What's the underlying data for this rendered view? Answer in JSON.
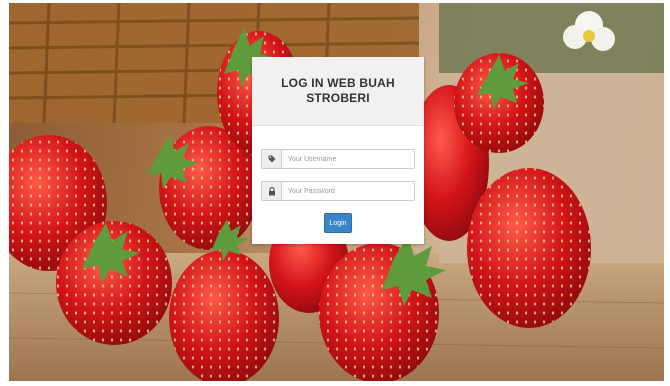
{
  "login": {
    "title": "LOG IN WEB BUAH STROBERI",
    "username": {
      "value": "",
      "placeholder": "Your Username"
    },
    "password": {
      "value": "",
      "placeholder": "Your Password"
    },
    "button_label": "Login"
  },
  "icons": {
    "username": "tag-icon",
    "password": "lock-icon"
  },
  "colors": {
    "button": "#3a85c8",
    "header_background": "#f1f1f1"
  }
}
